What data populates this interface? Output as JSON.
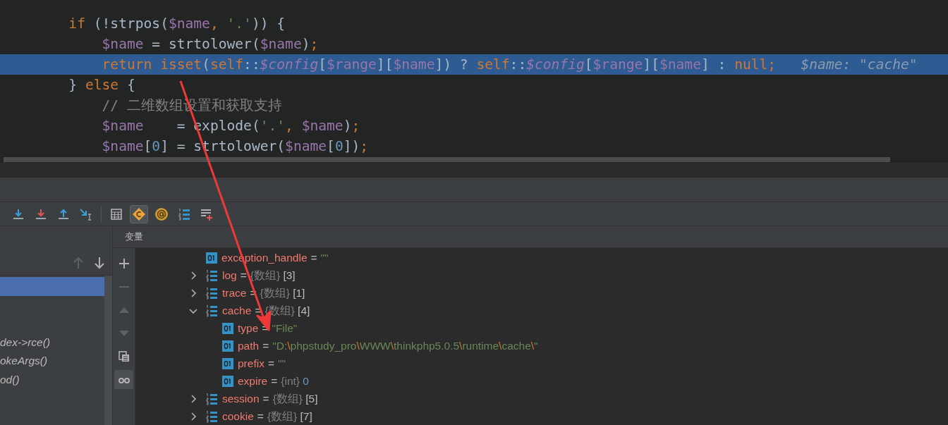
{
  "editor": {
    "lines": [
      {
        "highlighted": false,
        "tokens": [
          {
            "text": "        if",
            "kind": "keyword"
          },
          {
            "text": " (!strpos(",
            "kind": "plain"
          },
          {
            "text": "$name",
            "kind": "var"
          },
          {
            "text": ", ",
            "kind": "keyword"
          },
          {
            "text": "'.'",
            "kind": "string"
          },
          {
            "text": ")) {",
            "kind": "plain"
          }
        ]
      },
      {
        "highlighted": false,
        "tokens": [
          {
            "text": "            $name",
            "kind": "var"
          },
          {
            "text": " = strtolower(",
            "kind": "plain"
          },
          {
            "text": "$name",
            "kind": "var"
          },
          {
            "text": ")",
            "kind": "plain"
          },
          {
            "text": ";",
            "kind": "keyword"
          }
        ]
      },
      {
        "highlighted": true,
        "inline_value": "$name: \"cache\"",
        "tokens": [
          {
            "text": "            return isset",
            "kind": "keyword"
          },
          {
            "text": "(",
            "kind": "plain"
          },
          {
            "text": "self",
            "kind": "keyword"
          },
          {
            "text": "::",
            "kind": "plain"
          },
          {
            "text": "$config",
            "kind": "field"
          },
          {
            "text": "[",
            "kind": "plain"
          },
          {
            "text": "$range",
            "kind": "var"
          },
          {
            "text": "][",
            "kind": "plain"
          },
          {
            "text": "$name",
            "kind": "var"
          },
          {
            "text": "]) ? ",
            "kind": "plain"
          },
          {
            "text": "self",
            "kind": "keyword"
          },
          {
            "text": "::",
            "kind": "plain"
          },
          {
            "text": "$config",
            "kind": "field"
          },
          {
            "text": "[",
            "kind": "plain"
          },
          {
            "text": "$range",
            "kind": "var"
          },
          {
            "text": "][",
            "kind": "plain"
          },
          {
            "text": "$name",
            "kind": "var"
          },
          {
            "text": "] : ",
            "kind": "plain"
          },
          {
            "text": "null;",
            "kind": "keyword"
          }
        ]
      },
      {
        "highlighted": false,
        "tokens": [
          {
            "text": "        } ",
            "kind": "plain"
          },
          {
            "text": "else",
            "kind": "keyword"
          },
          {
            "text": " {",
            "kind": "plain"
          }
        ]
      },
      {
        "highlighted": false,
        "tokens": [
          {
            "text": "            // 二维数组设置和获取支持",
            "kind": "comment"
          }
        ]
      },
      {
        "highlighted": false,
        "tokens": [
          {
            "text": "            $name",
            "kind": "var"
          },
          {
            "text": "    = explode(",
            "kind": "plain"
          },
          {
            "text": "'.'",
            "kind": "string"
          },
          {
            "text": ", ",
            "kind": "keyword"
          },
          {
            "text": "$name",
            "kind": "var"
          },
          {
            "text": ")",
            "kind": "plain"
          },
          {
            "text": ";",
            "kind": "keyword"
          }
        ]
      },
      {
        "highlighted": false,
        "tokens": [
          {
            "text": "            $name",
            "kind": "var"
          },
          {
            "text": "[",
            "kind": "plain"
          },
          {
            "text": "0",
            "kind": "number"
          },
          {
            "text": "] = strtolower(",
            "kind": "plain"
          },
          {
            "text": "$name",
            "kind": "var"
          },
          {
            "text": "[",
            "kind": "plain"
          },
          {
            "text": "0",
            "kind": "number"
          },
          {
            "text": "])",
            "kind": "plain"
          },
          {
            "text": ";",
            "kind": "keyword"
          }
        ]
      }
    ]
  },
  "toolbar": {
    "groups": [
      {
        "buttons": [
          {
            "kind": "step_over",
            "selected": false
          },
          {
            "kind": "force_step",
            "selected": false
          },
          {
            "kind": "step_out",
            "selected": false
          },
          {
            "kind": "run_to_cursor",
            "selected": false
          }
        ]
      },
      {
        "buttons": [
          {
            "kind": "evaluate",
            "selected": false
          },
          {
            "kind": "class",
            "selected": true
          },
          {
            "kind": "at",
            "selected": false
          },
          {
            "kind": "numbered",
            "selected": false
          },
          {
            "kind": "add_list",
            "selected": false
          }
        ]
      }
    ]
  },
  "frames": {
    "items": [
      {
        "selected": true
      },
      {
        "selected": false
      },
      {
        "selected": false
      },
      {
        "selected": false,
        "label": "dex->rce()"
      },
      {
        "selected": false,
        "label": "okeArgs()"
      },
      {
        "selected": false,
        "label": "od()"
      }
    ]
  },
  "variables": {
    "title": "变量",
    "side_buttons": [
      {
        "kind": "add",
        "disabled": false,
        "selected": false
      },
      {
        "kind": "remove",
        "disabled": true,
        "selected": false
      },
      {
        "kind": "up",
        "disabled": true,
        "selected": false
      },
      {
        "kind": "down",
        "disabled": true,
        "selected": false
      },
      {
        "kind": "copy",
        "disabled": false,
        "selected": false
      },
      {
        "kind": "glasses",
        "disabled": false,
        "selected": true
      }
    ],
    "tree": [
      {
        "kind": "scalar",
        "name": "exception_handle",
        "op": "=",
        "value": [
          {
            "text": "\"\"",
            "kind": "string"
          }
        ]
      },
      {
        "kind": "array",
        "name": "log",
        "op": "=",
        "expanded": false,
        "value": [
          {
            "text": "{数组}",
            "kind": "type"
          },
          {
            "text": "[3]",
            "kind": "count"
          }
        ]
      },
      {
        "kind": "array",
        "name": "trace",
        "op": "=",
        "expanded": false,
        "value": [
          {
            "text": "{数组}",
            "kind": "type"
          },
          {
            "text": "[1]",
            "kind": "count"
          }
        ]
      },
      {
        "kind": "array",
        "name": "cache",
        "op": "=",
        "expanded": true,
        "value": [
          {
            "text": "{数组}",
            "kind": "type"
          },
          {
            "text": "[4]",
            "kind": "count"
          }
        ],
        "children": [
          {
            "kind": "scalar",
            "name": "type",
            "op": "=",
            "value": [
              {
                "text": "\"File\"",
                "kind": "string"
              }
            ]
          },
          {
            "kind": "scalar",
            "name": "path",
            "op": "=",
            "value": [
              {
                "text": "\"D:",
                "kind": "string"
              },
              {
                "text": "\\",
                "kind": "escape"
              },
              {
                "text": "phpstudy_pro",
                "kind": "string"
              },
              {
                "text": "\\",
                "kind": "escape"
              },
              {
                "text": "WWW",
                "kind": "string"
              },
              {
                "text": "\\",
                "kind": "escape"
              },
              {
                "text": "thinkphp5.0.5",
                "kind": "string"
              },
              {
                "text": "\\",
                "kind": "escape"
              },
              {
                "text": "runtime",
                "kind": "string"
              },
              {
                "text": "\\",
                "kind": "escape"
              },
              {
                "text": "cache",
                "kind": "string"
              },
              {
                "text": "\\",
                "kind": "escape"
              },
              {
                "text": "\"",
                "kind": "string"
              }
            ]
          },
          {
            "kind": "scalar",
            "name": "prefix",
            "op": "=",
            "value": [
              {
                "text": "\"\"",
                "kind": "string"
              }
            ]
          },
          {
            "kind": "scalar",
            "name": "expire",
            "op": "=",
            "value": [
              {
                "text": "{int}",
                "kind": "type"
              },
              {
                "text": "0",
                "kind": "number"
              }
            ]
          }
        ]
      },
      {
        "kind": "array",
        "name": "session",
        "op": "=",
        "expanded": false,
        "value": [
          {
            "text": "{数组}",
            "kind": "type"
          },
          {
            "text": "[5]",
            "kind": "count"
          }
        ]
      },
      {
        "kind": "array",
        "name": "cookie",
        "op": "=",
        "expanded": false,
        "value": [
          {
            "text": "{数组}",
            "kind": "type"
          },
          {
            "text": "[7]",
            "kind": "count"
          }
        ]
      }
    ]
  }
}
